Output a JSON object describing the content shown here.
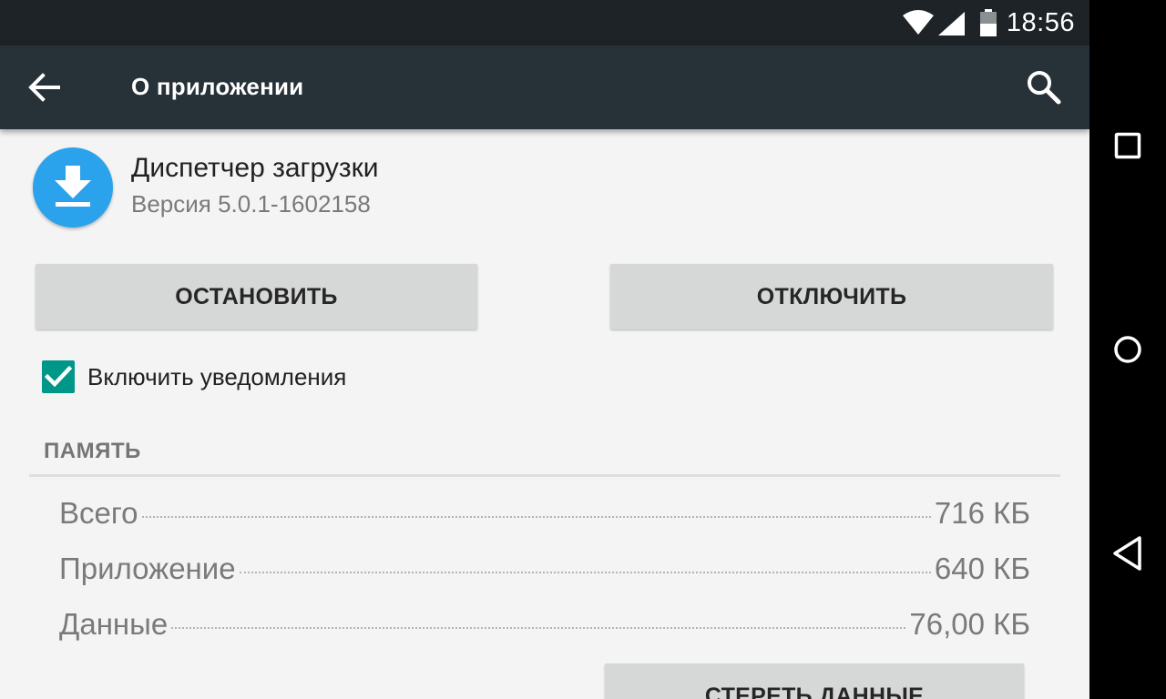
{
  "status_bar": {
    "time": "18:56",
    "icons": [
      "wifi-icon",
      "signal-icon",
      "battery-icon"
    ]
  },
  "app_bar": {
    "title": "О приложении",
    "back_icon": "arrow-back-icon",
    "search_icon": "search-icon"
  },
  "app": {
    "name": "Диспетчер загрузки",
    "version": "Версия 5.0.1-1602158",
    "icon": "download-icon",
    "icon_color": "#2aa3ec"
  },
  "buttons": {
    "stop": "ОСТАНОВИТЬ",
    "disable": "ОТКЛЮЧИТЬ",
    "clear_data": "СТЕРЕТЬ ДАННЫЕ"
  },
  "notifications": {
    "label": "Включить уведомления",
    "checked": true,
    "checkbox_color": "#009688"
  },
  "memory": {
    "header": "ПАМЯТЬ",
    "rows": [
      {
        "label": "Всего",
        "value": "716 КБ"
      },
      {
        "label": "Приложение",
        "value": "640 КБ"
      },
      {
        "label": "Данные",
        "value": "76,00 КБ"
      }
    ]
  },
  "nav_bar": {
    "icons": [
      "recents-icon",
      "home-icon",
      "back-icon"
    ]
  },
  "colors": {
    "status_bar": "#1d2327",
    "app_bar": "#263238",
    "background": "#f4f4f4",
    "button": "#d6d7d7"
  }
}
